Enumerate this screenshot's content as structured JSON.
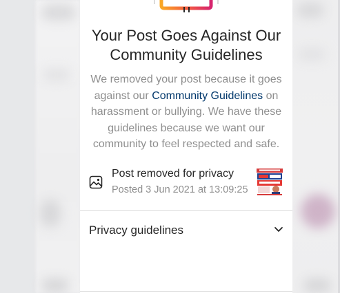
{
  "sheet": {
    "title_line1": "Your Post Goes Against Our",
    "title_line2": "Community Guidelines",
    "body_before_link": "We removed your post because it goes against our ",
    "body_link": "Community Guidelines",
    "body_after_link": " on harassment or bullying. We have these guidelines because we want our community to feel respected and safe."
  },
  "removed_post": {
    "title": "Post removed for privacy",
    "posted": "Posted 3 Jun 2021 at 13:09:25",
    "icon": "image-icon"
  },
  "privacy": {
    "label": "Privacy guidelines",
    "icon": "chevron-down-icon"
  },
  "colors": {
    "text_primary": "#262626",
    "text_secondary": "#8e8e8e",
    "link": "#00376b",
    "divider": "#dbdbdb"
  }
}
